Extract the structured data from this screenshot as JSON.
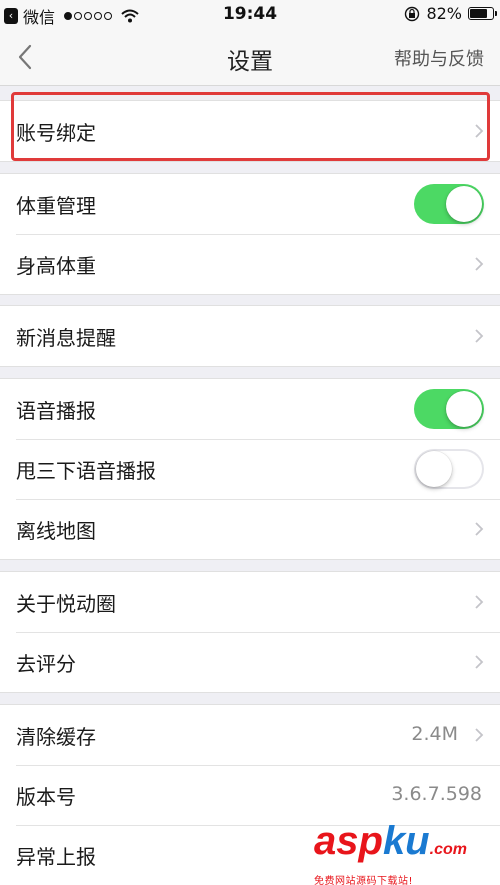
{
  "status_bar": {
    "carrier": "微信",
    "time": "19:44",
    "battery": "82%",
    "battery_level": 0.82,
    "signal_dots_filled": 1,
    "signal_dots_total": 5
  },
  "nav": {
    "title": "设置",
    "help_label": "帮助与反馈"
  },
  "groups": [
    {
      "rows": [
        {
          "label": "账号绑定",
          "accessory": "chevron",
          "highlighted": true
        }
      ]
    },
    {
      "rows": [
        {
          "label": "体重管理",
          "accessory": "toggle",
          "on": true
        },
        {
          "label": "身高体重",
          "accessory": "chevron"
        }
      ]
    },
    {
      "rows": [
        {
          "label": "新消息提醒",
          "accessory": "chevron"
        }
      ]
    },
    {
      "rows": [
        {
          "label": "语音播报",
          "accessory": "toggle",
          "on": true
        },
        {
          "label": "甩三下语音播报",
          "accessory": "toggle",
          "on": false
        },
        {
          "label": "离线地图",
          "accessory": "chevron"
        }
      ]
    },
    {
      "rows": [
        {
          "label": "关于悦动圈",
          "accessory": "chevron"
        },
        {
          "label": "去评分",
          "accessory": "chevron"
        }
      ]
    },
    {
      "rows": [
        {
          "label": "清除缓存",
          "accessory": "chevron",
          "value": "2.4M"
        },
        {
          "label": "版本号",
          "accessory": "value",
          "value": "3.6.7.598"
        },
        {
          "label": "异常上报",
          "accessory": "none"
        }
      ]
    }
  ],
  "colors": {
    "toggle_on": "#4cd964",
    "highlight": "#e03a3a",
    "background": "#efeff4"
  },
  "watermark": {
    "logo_asp": "asp",
    "logo_ku": "ku",
    "logo_com": ".com",
    "subtitle": "免费网站源码下载站!"
  }
}
